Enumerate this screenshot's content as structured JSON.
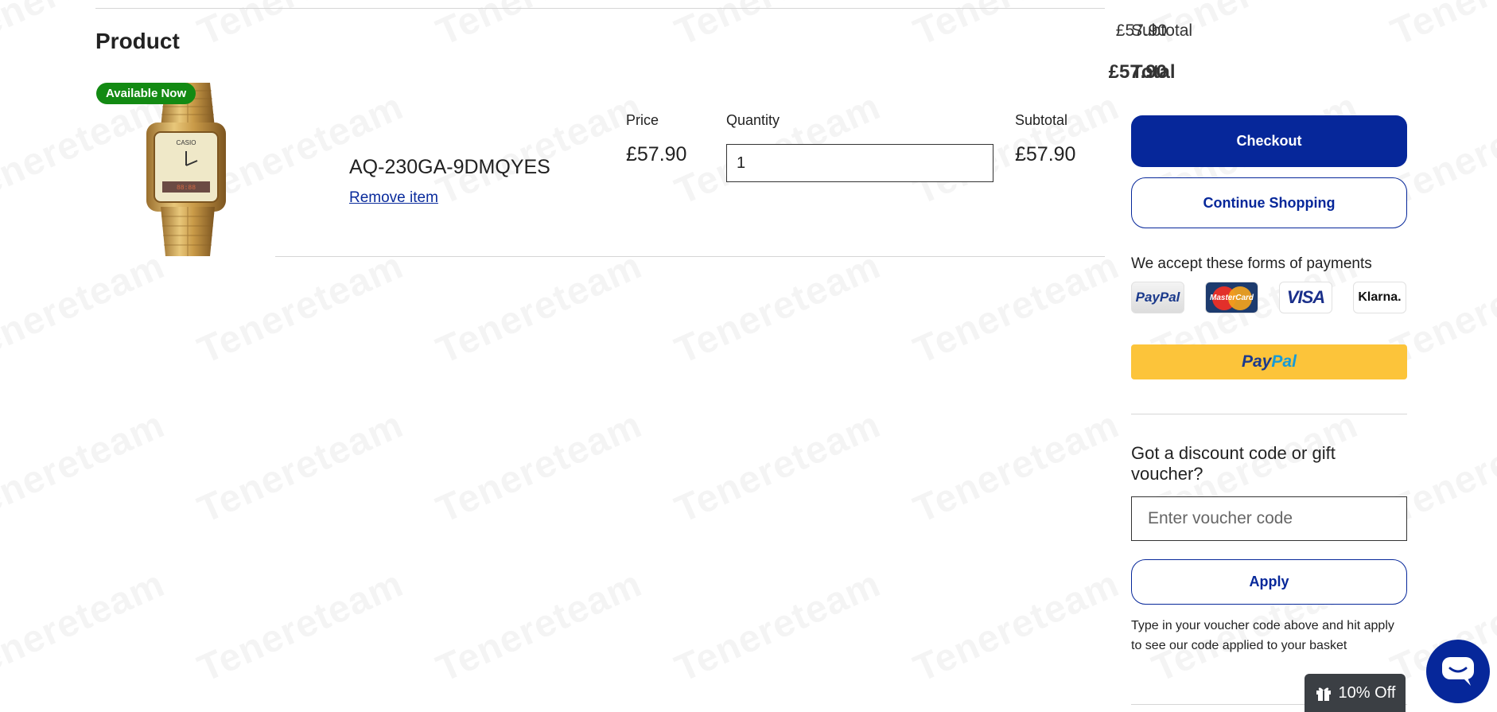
{
  "watermark": {
    "text": "Tenereteam"
  },
  "cart": {
    "heading": "Product",
    "item": {
      "badge": "Available Now",
      "image_alt": "gold digital-analog wristwatch",
      "code": "AQ-230GA-9DMQYES",
      "remove_label": "Remove item",
      "price_label": "Price",
      "price": "£57.90",
      "quantity_label": "Quantity",
      "quantity": "1",
      "subtotal_label": "Subtotal",
      "subtotal": "£57.90"
    }
  },
  "summary": {
    "subtotal_label": "Subtotal",
    "subtotal_value": "£57.90",
    "total_label": "Total",
    "total_value": "£57.90",
    "checkout_label": "Checkout",
    "continue_label": "Continue Shopping",
    "payments_heading": "We accept these forms of payments",
    "payment_methods": [
      "PayPal",
      "MasterCard",
      "VISA",
      "Klarna."
    ],
    "paypal_button": {
      "part1": "Pay",
      "part2": "Pal"
    }
  },
  "discount": {
    "heading": "Got a discount code or gift voucher?",
    "placeholder": "Enter voucher code",
    "apply_label": "Apply",
    "help_text": "Type in your voucher code above and hit apply to see our code applied to your basket"
  },
  "promo": {
    "label": "10% Off",
    "icon": "gift-icon"
  },
  "chat": {
    "icon": "chat-icon"
  },
  "colors": {
    "brand_blue": "#06279a",
    "badge_green": "#138a13",
    "paypal_yellow": "#fcc43a",
    "promo_dark": "#3b3f44"
  }
}
